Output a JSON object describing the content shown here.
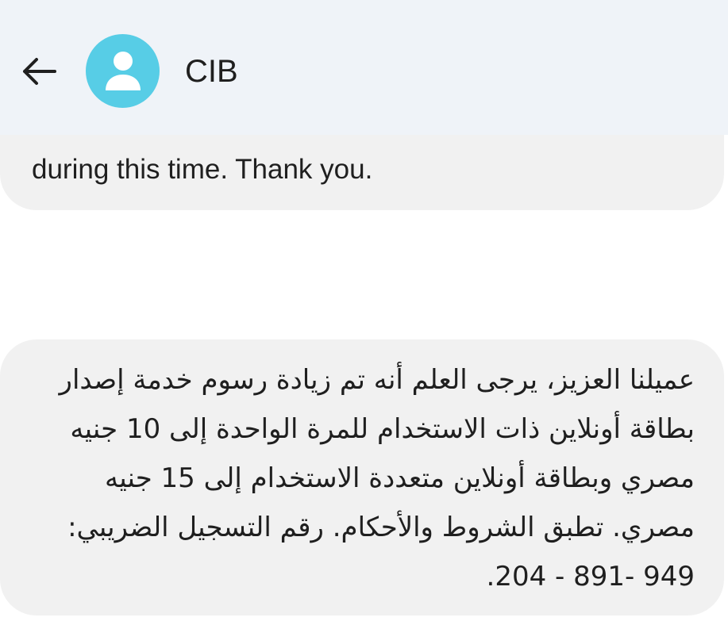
{
  "header": {
    "contact_name": "CIB",
    "back_icon": "arrow-left-icon",
    "avatar_icon": "person-icon",
    "avatar_color": "#57cde6",
    "background": "#eff3f8"
  },
  "messages": [
    {
      "text": "during this time. Thank you."
    },
    {
      "lines": [
        "عميلنا العزيز، يرجى العلم أنه تم زيادة رسوم خدمة إصدار",
        "بطاقة أونلاين ذات الاستخدام للمرة الواحدة إلى 10 جنيه",
        "مصري وبطاقة أونلاين متعددة الاستخدام إلى 15 جنيه",
        "مصري. تطبق الشروط والأحكام. رقم التسجيل الضريبي:",
        "949 -891 - 204."
      ]
    }
  ]
}
